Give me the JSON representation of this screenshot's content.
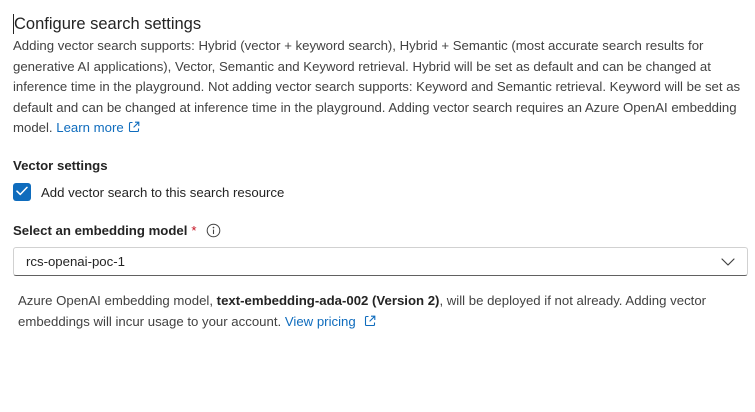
{
  "title": "Configure search settings",
  "description": {
    "text": "Adding vector search supports: Hybrid (vector + keyword search), Hybrid + Semantic (most accurate search results for generative AI applications), Vector, Semantic and Keyword retrieval. Hybrid will be set as default and can be changed at inference time in the playground. Not adding vector search supports: Keyword and Semantic retrieval. Keyword will be set as default and can be changed at inference time in the playground. Adding vector search requires an Azure OpenAI embedding model.",
    "link_label": "Learn more"
  },
  "vector_settings": {
    "section_label": "Vector settings",
    "checkbox_label": "Add vector search to this search resource",
    "checked": true
  },
  "embedding_model": {
    "label": "Select an embedding model",
    "required_marker": "*",
    "selected_value": "rcs-openai-poc-1"
  },
  "deployment_note": {
    "prefix": "Azure OpenAI embedding model, ",
    "model_name": "text-embedding-ada-002 (Version 2)",
    "suffix": ", will be deployed if not already. Adding vector embeddings will incur usage to your account.",
    "link_label": "View pricing"
  },
  "colors": {
    "accent": "#0f6cbd",
    "required": "#c50f1f",
    "text": "#242424"
  },
  "icons": [
    "external-link-icon",
    "checkmark-icon",
    "info-icon",
    "chevron-down-icon"
  ]
}
